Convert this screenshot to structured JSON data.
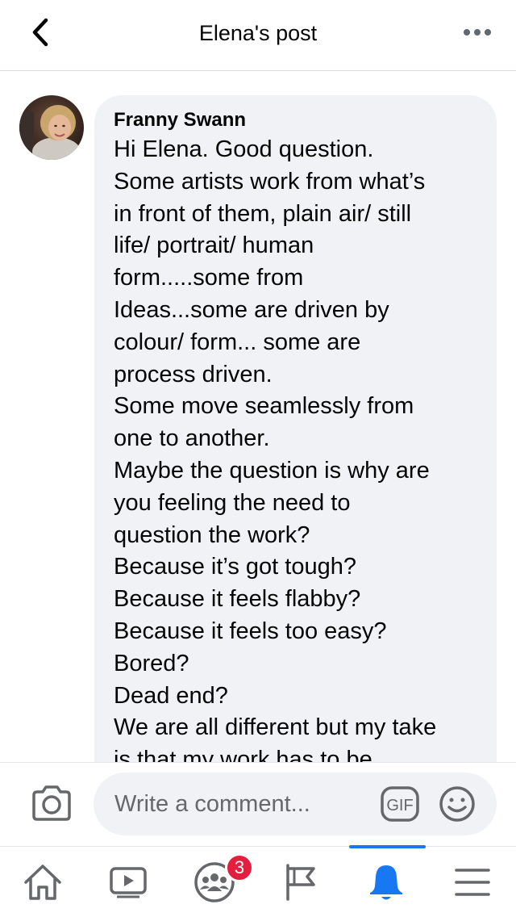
{
  "header": {
    "title": "Elena's post",
    "back_icon": "chevron-left-icon",
    "more_icon": "more-horizontal-icon"
  },
  "comment": {
    "author": "Franny Swann",
    "lines": [
      "Hi Elena. Good question.",
      "Some artists work from what’s",
      "in front of them,  plain air/ still",
      "life/ portrait/ human",
      "form.....some from",
      "Ideas...some are driven by",
      "colour/ form... some are",
      "process driven.",
      "Some move seamlessly from",
      "one to another.",
      "Maybe the question is why are",
      "you feeling the need to",
      "question the work?",
      "Because it’s got tough?",
      "Because it feels flabby?",
      "Because it feels too easy?",
      "Bored?",
      "Dead end?",
      "We are all different but my take",
      "is that my work has to be"
    ]
  },
  "composer": {
    "placeholder": "Write a comment...",
    "camera_icon": "camera-icon",
    "gif_label": "GIF",
    "emoji_icon": "smiley-icon"
  },
  "tabbar": {
    "tabs": [
      {
        "name": "home",
        "icon": "home-icon"
      },
      {
        "name": "watch",
        "icon": "video-icon"
      },
      {
        "name": "groups",
        "icon": "groups-icon",
        "badge": "3"
      },
      {
        "name": "pages",
        "icon": "flag-icon"
      },
      {
        "name": "notifications",
        "icon": "bell-icon",
        "active": true
      },
      {
        "name": "menu",
        "icon": "menu-icon"
      }
    ]
  },
  "colors": {
    "accent": "#1877f2",
    "badge": "#e41e3f",
    "bubble": "#f0f2f5",
    "icon": "#65676b"
  }
}
